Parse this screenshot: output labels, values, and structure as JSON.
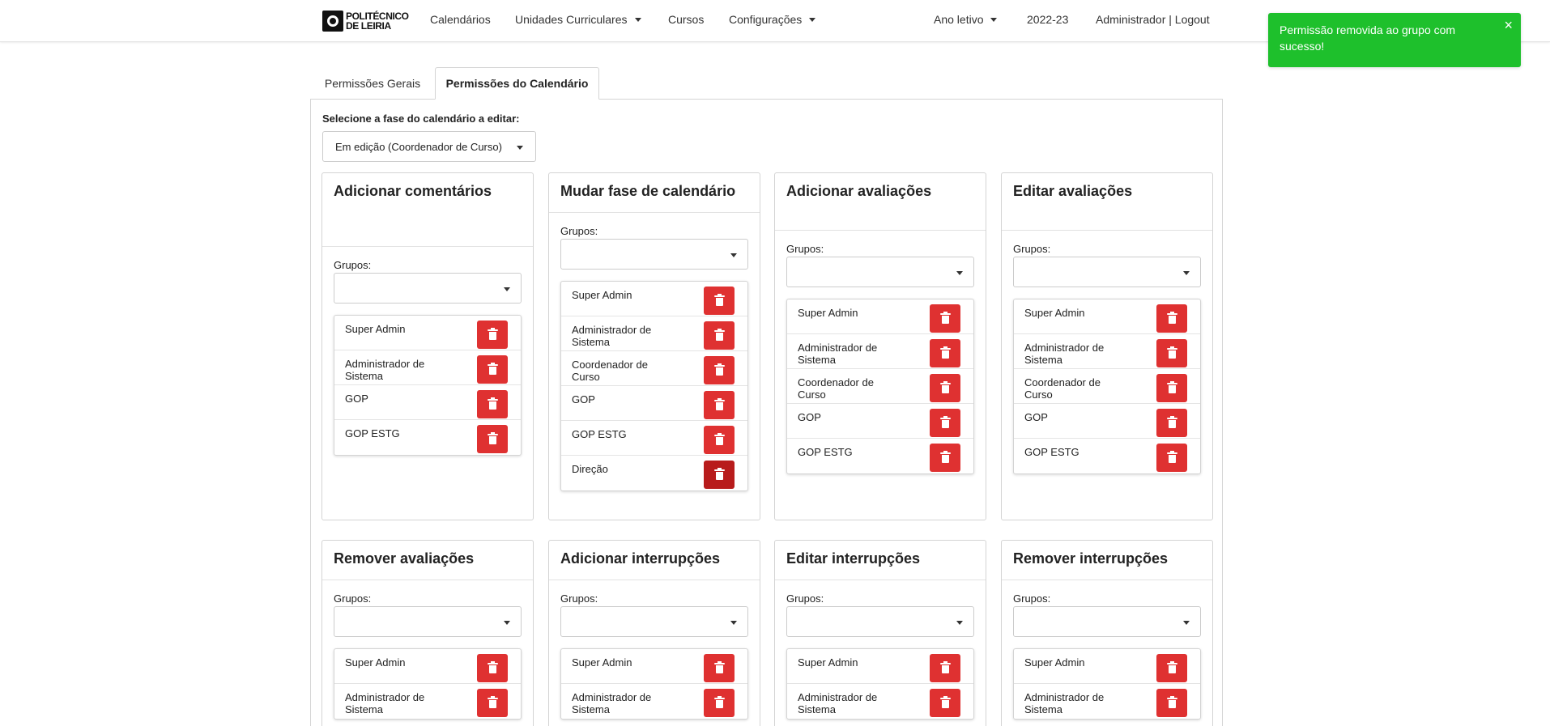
{
  "nav": {
    "logo_line1": "POLITÉCNICO",
    "logo_line2": "DE LEIRIA",
    "items": [
      "Calendários",
      "Unidades Curriculares",
      "Cursos",
      "Configurações"
    ],
    "year_label": "Ano letivo",
    "year_value": "2022-23",
    "user_text": "Administrador | Logout"
  },
  "toast": {
    "message": "Permissão removida ao grupo com sucesso!",
    "close": "×",
    "color": "#1ec02c"
  },
  "tabs": [
    "Permissões Gerais",
    "Permissões do Calendário"
  ],
  "phase": {
    "label": "Selecione a fase do calendário a editar:",
    "selected": "Em edição (Coordenador de Curso)"
  },
  "grupos_label": "Grupos:",
  "cards": [
    {
      "title": "Adicionar comentários",
      "groups": [
        "Super Admin",
        "Administrador de Sistema",
        "GOP",
        "GOP ESTG"
      ]
    },
    {
      "title": "Mudar fase de calendário",
      "groups": [
        "Super Admin",
        "Administrador de Sistema",
        "Coordenador de Curso",
        "GOP",
        "GOP ESTG",
        "Direção"
      ]
    },
    {
      "title": "Adicionar avaliações",
      "groups": [
        "Super Admin",
        "Administrador de Sistema",
        "Coordenador de Curso",
        "GOP",
        "GOP ESTG"
      ]
    },
    {
      "title": "Editar avaliações",
      "groups": [
        "Super Admin",
        "Administrador de Sistema",
        "Coordenador de Curso",
        "GOP",
        "GOP ESTG"
      ]
    },
    {
      "title": "Remover avaliações",
      "groups": [
        "Super Admin",
        "Administrador de Sistema"
      ]
    },
    {
      "title": "Adicionar interrupções",
      "groups": [
        "Super Admin",
        "Administrador de Sistema"
      ]
    },
    {
      "title": "Editar interrupções",
      "groups": [
        "Super Admin",
        "Administrador de Sistema"
      ]
    },
    {
      "title": "Remover interrupções",
      "groups": [
        "Super Admin",
        "Administrador de Sistema"
      ]
    }
  ],
  "colors": {
    "delete": "#df3131",
    "delete_pressed": "#b81c1c"
  }
}
